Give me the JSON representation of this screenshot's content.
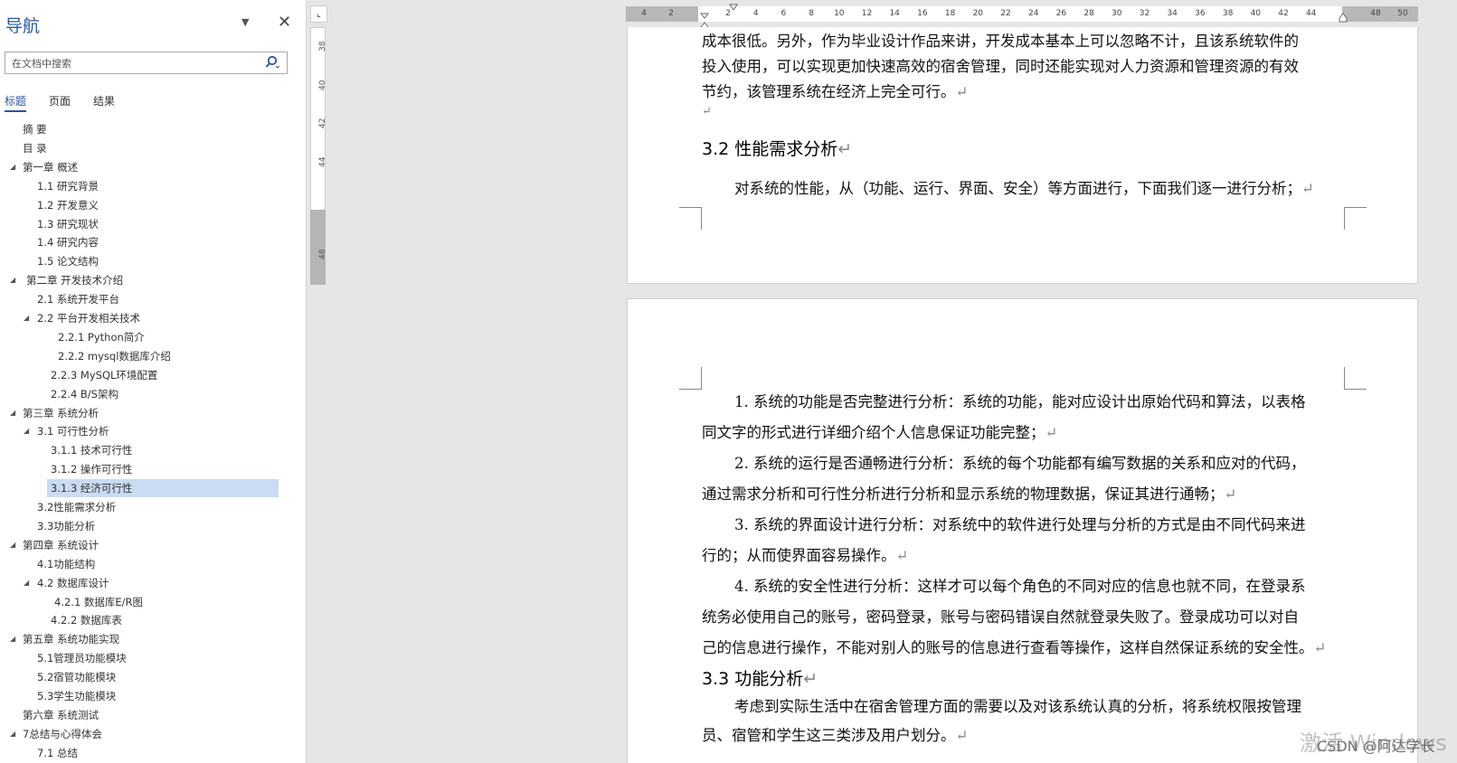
{
  "nav": {
    "title": "导航",
    "dropdown": "▼",
    "close": "✕",
    "search_placeholder": "在文档中搜索",
    "tabs": [
      "标题",
      "页面",
      "结果"
    ],
    "items": [
      {
        "label": "摘  要",
        "arrow": ""
      },
      {
        "label": "目  录",
        "arrow": ""
      },
      {
        "label": "第一章 概述",
        "arrow": "◢"
      },
      {
        "label": "1.1 研究背景",
        "arrow": ""
      },
      {
        "label": "1.2 开发意义",
        "arrow": ""
      },
      {
        "label": "1.3 研究现状",
        "arrow": ""
      },
      {
        "label": "1.4 研究内容",
        "arrow": ""
      },
      {
        "label": "1.5 论文结构",
        "arrow": ""
      },
      {
        "label": "第二章 开发技术介绍",
        "arrow": "◢"
      },
      {
        "label": "2.1 系统开发平台",
        "arrow": ""
      },
      {
        "label": "2.2 平台开发相关技术",
        "arrow": "◢"
      },
      {
        "label": "2.2.1   Python简介",
        "arrow": ""
      },
      {
        "label": "2.2.2   mysql数据库介绍",
        "arrow": ""
      },
      {
        "label": "2.2.3   MySQL环境配置",
        "arrow": ""
      },
      {
        "label": "2.2.4   B/S架构",
        "arrow": ""
      },
      {
        "label": "第三章 系统分析",
        "arrow": "◢"
      },
      {
        "label": "3.1 可行性分析",
        "arrow": "◢"
      },
      {
        "label": "3.1.1 技术可行性",
        "arrow": ""
      },
      {
        "label": "3.1.2 操作可行性",
        "arrow": ""
      },
      {
        "label": "3.1.3 经济可行性",
        "arrow": "",
        "selected": true
      },
      {
        "label": "3.2性能需求分析",
        "arrow": ""
      },
      {
        "label": "3.3功能分析",
        "arrow": ""
      },
      {
        "label": "第四章 系统设计",
        "arrow": "◢"
      },
      {
        "label": "4.1功能结构",
        "arrow": ""
      },
      {
        "label": "4.2 数据库设计",
        "arrow": "◢"
      },
      {
        "label": "4.2.1 数据库E/R图",
        "arrow": ""
      },
      {
        "label": "4.2.2 数据库表",
        "arrow": ""
      },
      {
        "label": "第五章 系统功能实现",
        "arrow": "◢"
      },
      {
        "label": "5.1管理员功能模块",
        "arrow": ""
      },
      {
        "label": "5.2宿管功能模块",
        "arrow": ""
      },
      {
        "label": "5.3学生功能模块",
        "arrow": ""
      },
      {
        "label": "第六章 系统测试",
        "arrow": ""
      },
      {
        "label": "7总结与心得体会",
        "arrow": "◢"
      },
      {
        "label": "7.1 总结",
        "arrow": ""
      }
    ]
  },
  "vruler": {
    "corner": "⌞",
    "ticks": [
      "38",
      "40",
      "42",
      "44",
      "48"
    ]
  },
  "hruler": {
    "ticks": [
      "4",
      "2",
      "2",
      "4",
      "6",
      "8",
      "10",
      "12",
      "14",
      "16",
      "18",
      "20",
      "22",
      "24",
      "26",
      "28",
      "30",
      "32",
      "34",
      "36",
      "38",
      "40",
      "42",
      "44",
      "48",
      "50"
    ]
  },
  "page1": {
    "lines": [
      "成本很低。另外，作为毕业设计作品来讲，开发成本基本上可以忽略不计，且该系统软件的",
      "投入使用，可以实现更加快速高效的宿舍管理，同时还能实现对人力资源和管理资源的有效",
      "节约，该管理系统在经济上完全可行。"
    ],
    "heading": "3.2 性能需求分析",
    "para": "对系统的性能，从（功能、运行、界面、安全）等方面进行，下面我们逐一进行分析；"
  },
  "page2": {
    "lines": [
      "1. 系统的功能是否完整进行分析：系统的功能，能对应设计出原始代码和算法，以表格",
      "同文字的形式进行详细介绍个人信息保证功能完整；",
      "2. 系统的运行是否通畅进行分析：系统的每个功能都有编写数据的关系和应对的代码，",
      "通过需求分析和可行性分析进行分析和显示系统的物理数据，保证其进行通畅；",
      "3. 系统的界面设计进行分析：对系统中的软件进行处理与分析的方式是由不同代码来进",
      "行的；从而使界面容易操作。",
      "4. 系统的安全性进行分析：这样才可以每个角色的不同对应的信息也就不同，在登录系",
      "统务必使用自己的账号，密码登录，账号与密码错误自然就登录失败了。登录成功可以对自",
      "己的信息进行操作，不能对别人的账号的信息进行查看等操作，这样自然保证系统的安全性。"
    ],
    "heading": "3.3 功能分析",
    "tail": [
      "考虑到实际生活中在宿舍管理方面的需要以及对该系统认真的分析，将系统权限按管理",
      "员、宿管和学生这三类涉及用户划分。"
    ]
  },
  "paragraph_mark": "↵",
  "watermark": "激活 Windows",
  "credit": "CSDN @阿达学长"
}
